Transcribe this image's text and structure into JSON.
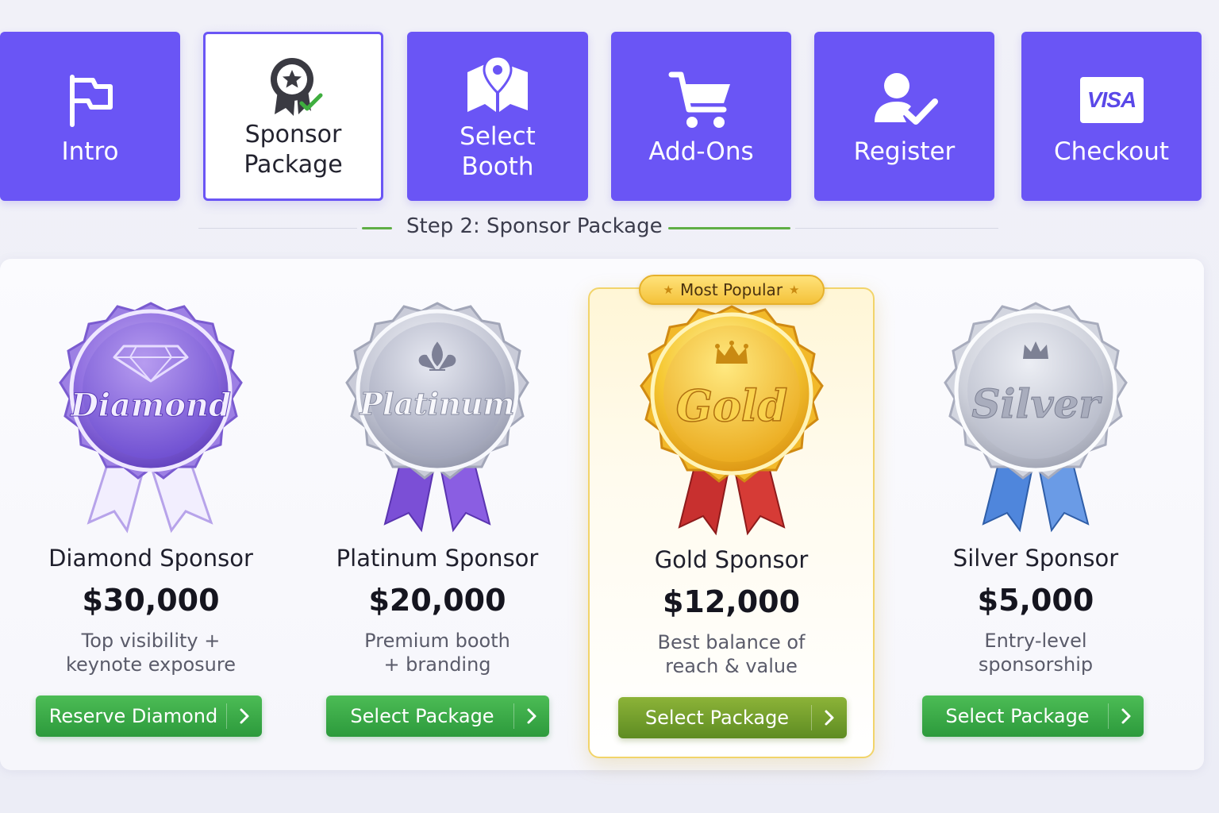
{
  "steps": [
    {
      "label": "Intro",
      "icon": "flag-icon",
      "active": false
    },
    {
      "label": "Sponsor\nPackage",
      "icon": "award-check-icon",
      "active": true
    },
    {
      "label": "Select\nBooth",
      "icon": "map-pin-icon",
      "active": false
    },
    {
      "label": "Add-Ons",
      "icon": "cart-icon",
      "active": false
    },
    {
      "label": "Register",
      "icon": "user-check-icon",
      "active": false
    },
    {
      "label": "Checkout",
      "icon": "visa-card-icon",
      "active": false,
      "card_text": "VISA"
    }
  ],
  "step_caption": "Step 2: Sponsor Package",
  "featured_badge": "Most Popular",
  "packages": [
    {
      "medal_text": "Diamond",
      "title": "Diamond Sponsor",
      "price": "$30,000",
      "description": "Top visibility +\nkeynote exposure",
      "button": "Reserve Diamond",
      "medal_color": "#8a6ad6",
      "ribbon_color": "#ffffff"
    },
    {
      "medal_text": "Platinum",
      "title": "Platinum Sponsor",
      "price": "$20,000",
      "description": "Premium booth\n+ branding",
      "button": "Select Package",
      "medal_color": "#b6b9c8",
      "ribbon_color": "#7a52d8"
    },
    {
      "medal_text": "Gold",
      "title": "Gold Sponsor",
      "price": "$12,000",
      "description": "Best balance of\nreach & value",
      "button": "Select Package",
      "medal_color": "#f2c234",
      "ribbon_color": "#c8302f",
      "featured": true
    },
    {
      "medal_text": "Silver",
      "title": "Silver Sponsor",
      "price": "$5,000",
      "description": "Entry-level\nsponsorship",
      "button": "Select Package",
      "medal_color": "#c5c9d4",
      "ribbon_color": "#5a8fe0"
    }
  ],
  "colors": {
    "step_bg": "#6a55f5",
    "button_green": "#35a845",
    "button_olive": "#6f9a2a",
    "caption_accent": "#5fae45"
  }
}
